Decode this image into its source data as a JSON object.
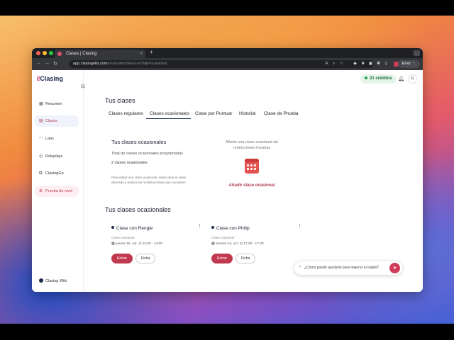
{
  "browser": {
    "tab_title": "Clases | Clasing",
    "tab_close": "×",
    "new_tab": "+",
    "url_host": "app.clasingelts.com",
    "url_path": "/es/student/lessons?tab=ocasional",
    "error_label": "Error"
  },
  "sidebar": {
    "logo": "Clasing",
    "items": [
      {
        "label": "Resumen",
        "icon": "grid-icon"
      },
      {
        "label": "Clases",
        "icon": "calendar-icon"
      },
      {
        "label": "Labs",
        "icon": "headset-icon"
      },
      {
        "label": "Roleplays",
        "icon": "roleplay-icon"
      },
      {
        "label": "ClasingGo",
        "icon": "go-icon"
      },
      {
        "label": "Prueba de nivel",
        "icon": "level-test-icon"
      }
    ],
    "wiki": "Clasing Wiki"
  },
  "header": {
    "credits": "21 créditos",
    "avatar_initial": "G"
  },
  "main": {
    "title": "Tus clases",
    "tabs": [
      "Clases regulares",
      "Clases ocasionales",
      "Clase por Puntuar",
      "Historial",
      "Clase de Prueba"
    ],
    "summary": {
      "title": "Tus clases ocasionales",
      "total_label": "Total de clases ocasionales programadas",
      "count": "2 clases ocasionales",
      "help": "Para editar una clase ocasional, selecciona la clase deseada y realiza las modificaciones que necesites."
    },
    "add": {
      "text": "Añade una clase ocasional sin restricciones horarias",
      "link": "Añadir clase ocasional"
    },
    "section_title": "Tus clases ocasionales",
    "classes": [
      {
        "name": "Clase con Rengie",
        "type": "Clase ocasional",
        "date": "jueves 16, oct",
        "time": "12:00 - 13:00",
        "enter": "Entrar",
        "sheet": "Ficha"
      },
      {
        "name": "Clase con Philip",
        "type": "Clase ocasional",
        "date": "viernes 24, oct",
        "time": "17:00 - 17:30",
        "enter": "Entrar",
        "sheet": "Ficha"
      }
    ]
  },
  "chat": {
    "placeholder": "¿Cómo puedo ayudarte para mejorar tu inglés?"
  },
  "colors": {
    "accent": "#c0394f",
    "brand_navy": "#1b2a4a",
    "credits_green": "#1f9d4b"
  }
}
